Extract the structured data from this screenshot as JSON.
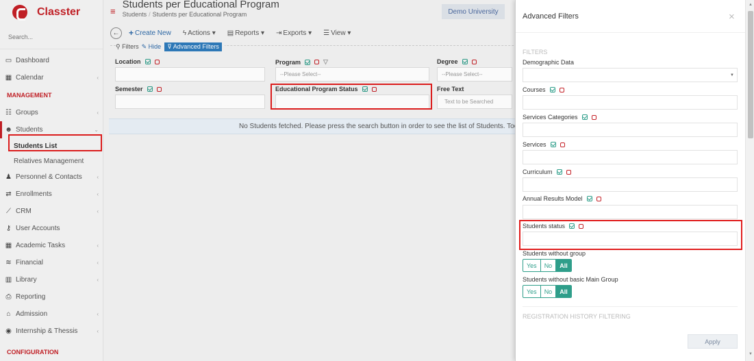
{
  "app": {
    "brand": "Classter",
    "university": "Demo University"
  },
  "sidebar": {
    "search_placeholder": "Search...",
    "items": [
      {
        "label": "Dashboard"
      },
      {
        "label": "Calendar"
      }
    ],
    "management_title": "MANAGEMENT",
    "management_items": [
      {
        "label": "Groups"
      },
      {
        "label": "Students"
      },
      {
        "label": "Students List"
      },
      {
        "label": "Relatives Management"
      },
      {
        "label": "Personnel & Contacts"
      },
      {
        "label": "Enrollments"
      },
      {
        "label": "CRM"
      },
      {
        "label": "User Accounts"
      },
      {
        "label": "Academic Tasks"
      },
      {
        "label": "Financial"
      },
      {
        "label": "Library"
      },
      {
        "label": "Reporting"
      },
      {
        "label": "Admission"
      },
      {
        "label": "Internship & Thessis"
      }
    ],
    "configuration_title": "CONFIGURATION"
  },
  "header": {
    "title": "Students per Educational Program",
    "breadcrumb": [
      "Students",
      "Students per Educational Program"
    ]
  },
  "toolbar": {
    "create_new": "Create New",
    "actions": "Actions",
    "reports": "Reports",
    "exports": "Exports",
    "view": "View"
  },
  "filters": {
    "filters_label": "Filters",
    "hide_label": "Hide",
    "advanced_label": "Advanced Filters",
    "location_label": "Location",
    "program_label": "Program",
    "program_placeholder": "--Please Select--",
    "degree_label": "Degree",
    "degree_placeholder": "--Please Select--",
    "semester_label": "Semester",
    "edu_status_label": "Educational Program Status",
    "free_text_label": "Free Text",
    "free_text_placeholder": "Text to be Searched"
  },
  "info_message": "No Students fetched. Please press the search button in order to see the list of Students. Tooltip",
  "modal": {
    "title": "Advanced Filters",
    "close": "×",
    "filters_section": "FILTERS",
    "fields": {
      "demographic": "Demographic Data",
      "courses": "Courses",
      "services_categories": "Services Categories",
      "services": "Services",
      "curriculum": "Curriculum",
      "annual_results": "Annual Results Model",
      "students_status": "Students status",
      "without_group": "Students without group",
      "without_basic_group": "Students without basic Main Group"
    },
    "toggle_options": [
      "Yes",
      "No",
      "All"
    ],
    "registration_section": "REGISTRATION HISTORY FILTERING",
    "apply": "Apply"
  }
}
